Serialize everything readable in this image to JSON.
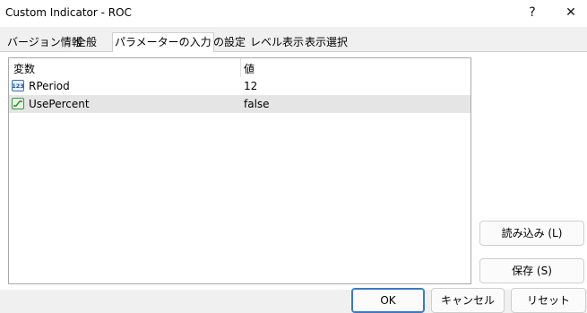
{
  "window": {
    "title": "Custom Indicator - ROC",
    "help_label": "?",
    "close_label": "✕"
  },
  "tabs": [
    {
      "label": "バージョン情報"
    },
    {
      "label": "全般"
    },
    {
      "label": "パラメーターの入力",
      "active": true
    },
    {
      "label": "色の設定"
    },
    {
      "label": "レベル表示"
    },
    {
      "label": "表示選択"
    }
  ],
  "params": {
    "columns": [
      "変数",
      "値"
    ],
    "rows": [
      {
        "name": "RPeriod",
        "value": "12",
        "icon": "integer-icon"
      },
      {
        "name": "UsePercent",
        "value": "false",
        "icon": "boolean-icon"
      }
    ],
    "selected_row": 1
  },
  "buttons": {
    "load": "読み込み (L)",
    "save": "保存 (S)",
    "ok": "OK",
    "cancel": "キャンセル",
    "reset": "リセット"
  },
  "colors": {
    "selected_row": "#e5e5e5",
    "default_button_border": "#3b78c6"
  }
}
